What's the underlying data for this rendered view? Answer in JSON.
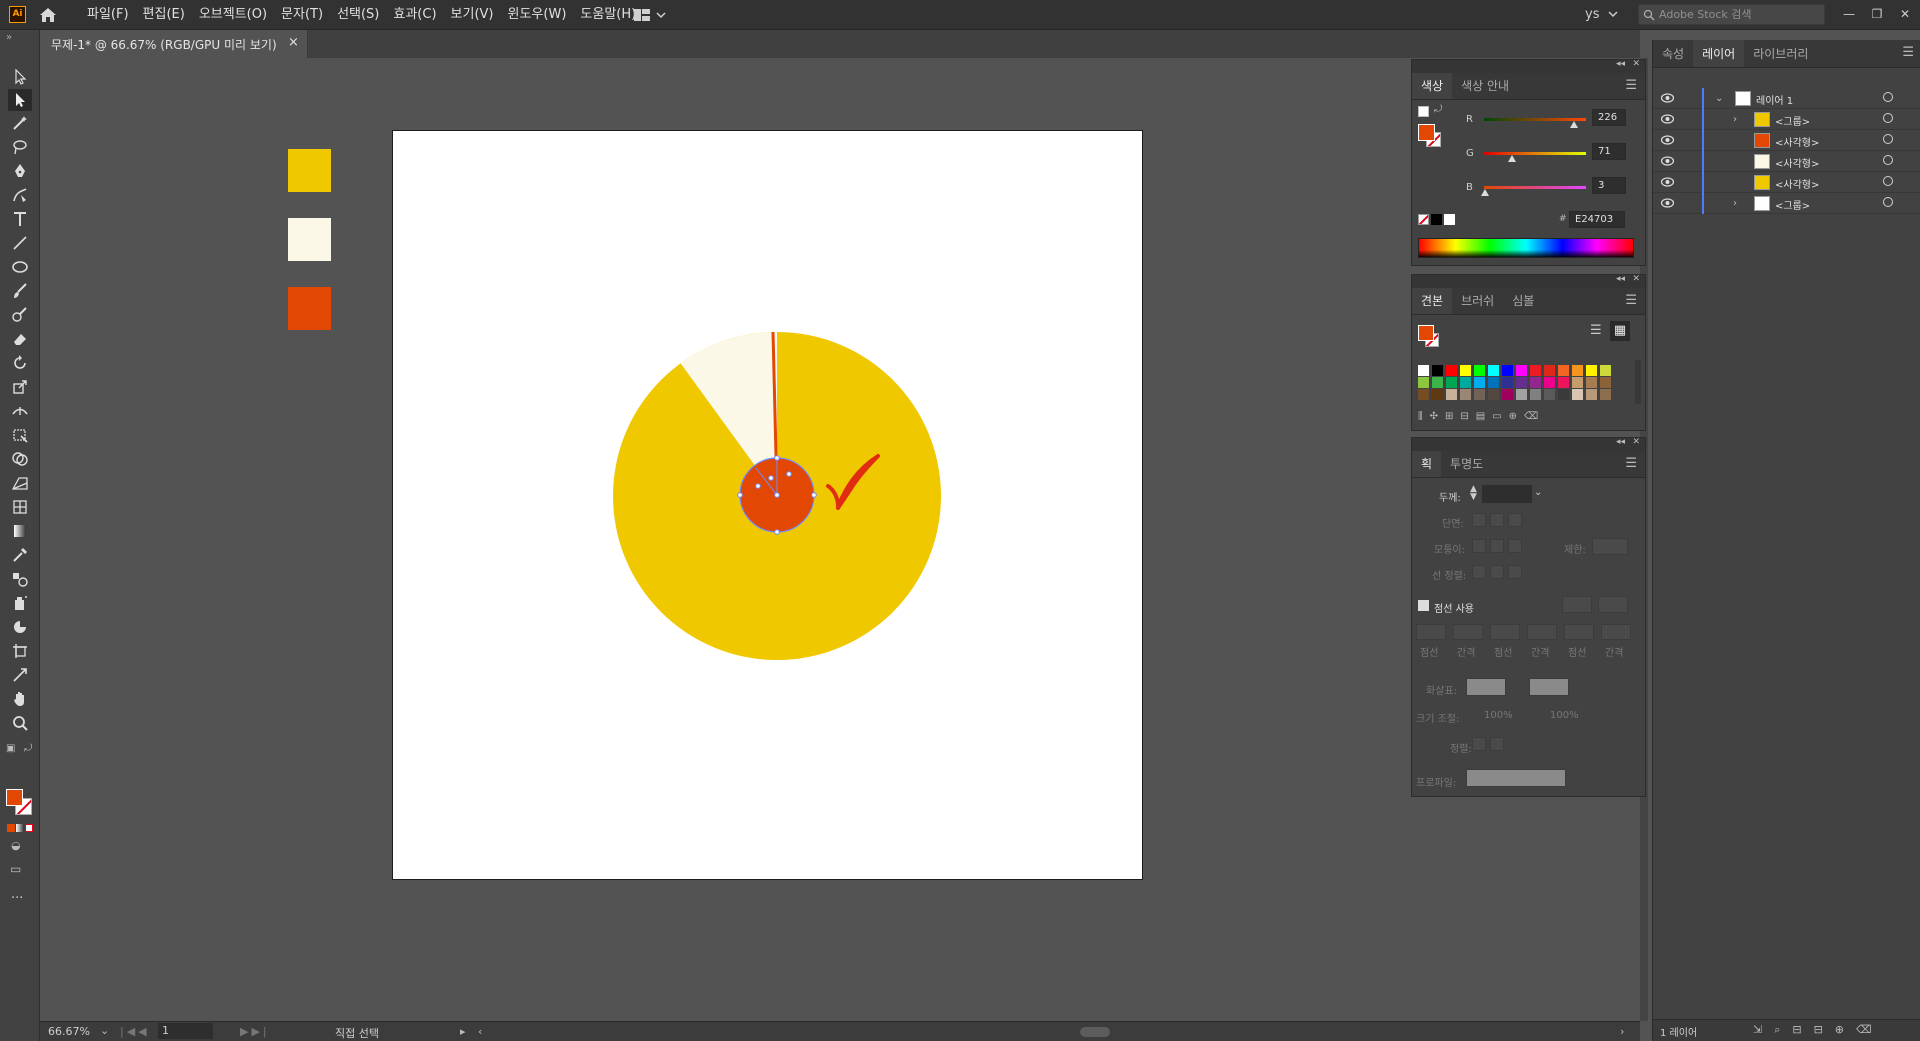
{
  "app": {
    "logo_text": "Ai",
    "user": "ys",
    "search_placeholder": "Adobe Stock 검색"
  },
  "menu": [
    "파일(F)",
    "편집(E)",
    "오브젝트(O)",
    "문자(T)",
    "선택(S)",
    "효과(C)",
    "보기(V)",
    "윈도우(W)",
    "도움말(H)"
  ],
  "document": {
    "tab_title": "무제-1* @ 66.67% (RGB/GPU 미리 보기)",
    "close": "×"
  },
  "status": {
    "zoom": "66.67%",
    "page": "1",
    "tool": "직접 선택"
  },
  "colors": {
    "fill": "#E24703",
    "yellow": "#F0C800",
    "cream": "#FCF8E8",
    "orange": "#E24703"
  },
  "color_panel": {
    "tabs": [
      "색상",
      "색상 안내"
    ],
    "channels": [
      {
        "label": "R",
        "value": "226",
        "fraction": 0.886
      },
      {
        "label": "G",
        "value": "71",
        "fraction": 0.278
      },
      {
        "label": "B",
        "value": "3",
        "fraction": 0.012
      }
    ],
    "hex_prefix": "#",
    "hex": "E24703"
  },
  "swatches_panel": {
    "tabs": [
      "견본",
      "브러쉬",
      "심볼"
    ],
    "swatches": [
      "#ffffff",
      "#000000",
      "#ff0000",
      "#ffff00",
      "#00ff00",
      "#00ffff",
      "#0000ff",
      "#ff00ff",
      "#ed1c24",
      "#e0281a",
      "#f26522",
      "#f7941d",
      "#fff200",
      "#ccdb3a",
      "#8dc63f",
      "#39b54a",
      "#00a651",
      "#00a99d",
      "#00aeef",
      "#0072bc",
      "#2e3192",
      "#662d91",
      "#92278f",
      "#ec008c",
      "#ed145b",
      "#c69c6d",
      "#a67c52",
      "#8c6239",
      "#754c24",
      "#603913",
      "#c7b299",
      "#998675",
      "#736357",
      "#534741",
      "#9e005d",
      "#a3a3a3",
      "#808080",
      "#5a5a5a",
      "#3a3a3a",
      "#d9c5b2",
      "#b99a78",
      "#8d6e4f"
    ]
  },
  "stroke_panel": {
    "tabs": [
      "획",
      "투명도"
    ],
    "weight_label": "두께:",
    "cap_label": "단면:",
    "corner_label": "모퉁이:",
    "limit_label": "제한:",
    "align_label": "선 정렬:",
    "dashed_label": "점선 사용",
    "dash_fields": [
      "점선",
      "간격",
      "점선",
      "간격",
      "점선",
      "간격"
    ],
    "arrow_label": "화살표:",
    "scale_label": "크기 조절:",
    "scale_values": [
      "100%",
      "100%"
    ],
    "align_arrow_label": "정렬:",
    "profile_label": "프로파일:"
  },
  "dock": {
    "tabs": [
      "속성",
      "레이어",
      "라이브러리"
    ],
    "layers": [
      {
        "name": "레이어 1",
        "thumb": "#ffffff",
        "expanded": true,
        "indent": 0
      },
      {
        "name": "<그룹>",
        "thumb": "#F0C800",
        "expanded": false,
        "indent": 1
      },
      {
        "name": "<사각형>",
        "thumb": "#E24703",
        "indent": 1
      },
      {
        "name": "<사각형>",
        "thumb": "#FCF8E8",
        "indent": 1
      },
      {
        "name": "<사각형>",
        "thumb": "#F0C800",
        "indent": 1
      },
      {
        "name": "<그룹>",
        "thumb": "#ffffff",
        "expanded": false,
        "indent": 1
      }
    ],
    "footer": "1 레이어"
  },
  "icons": [
    "home-icon",
    "selection-tool-icon",
    "direct-selection-tool-icon",
    "magic-wand-icon",
    "lasso-icon",
    "pen-icon",
    "curvature-icon",
    "type-icon",
    "line-icon",
    "ellipse-icon",
    "paintbrush-icon",
    "shaper-icon",
    "eraser-icon",
    "rotate-icon",
    "scale-icon",
    "width-icon",
    "free-transform-icon",
    "shape-builder-icon",
    "perspective-icon",
    "mesh-icon",
    "gradient-icon",
    "eyedropper-icon",
    "blend-icon",
    "symbol-sprayer-icon",
    "graph-icon",
    "artboard-icon",
    "slice-icon",
    "hand-icon",
    "zoom-icon",
    "eye-icon",
    "search-icon"
  ]
}
